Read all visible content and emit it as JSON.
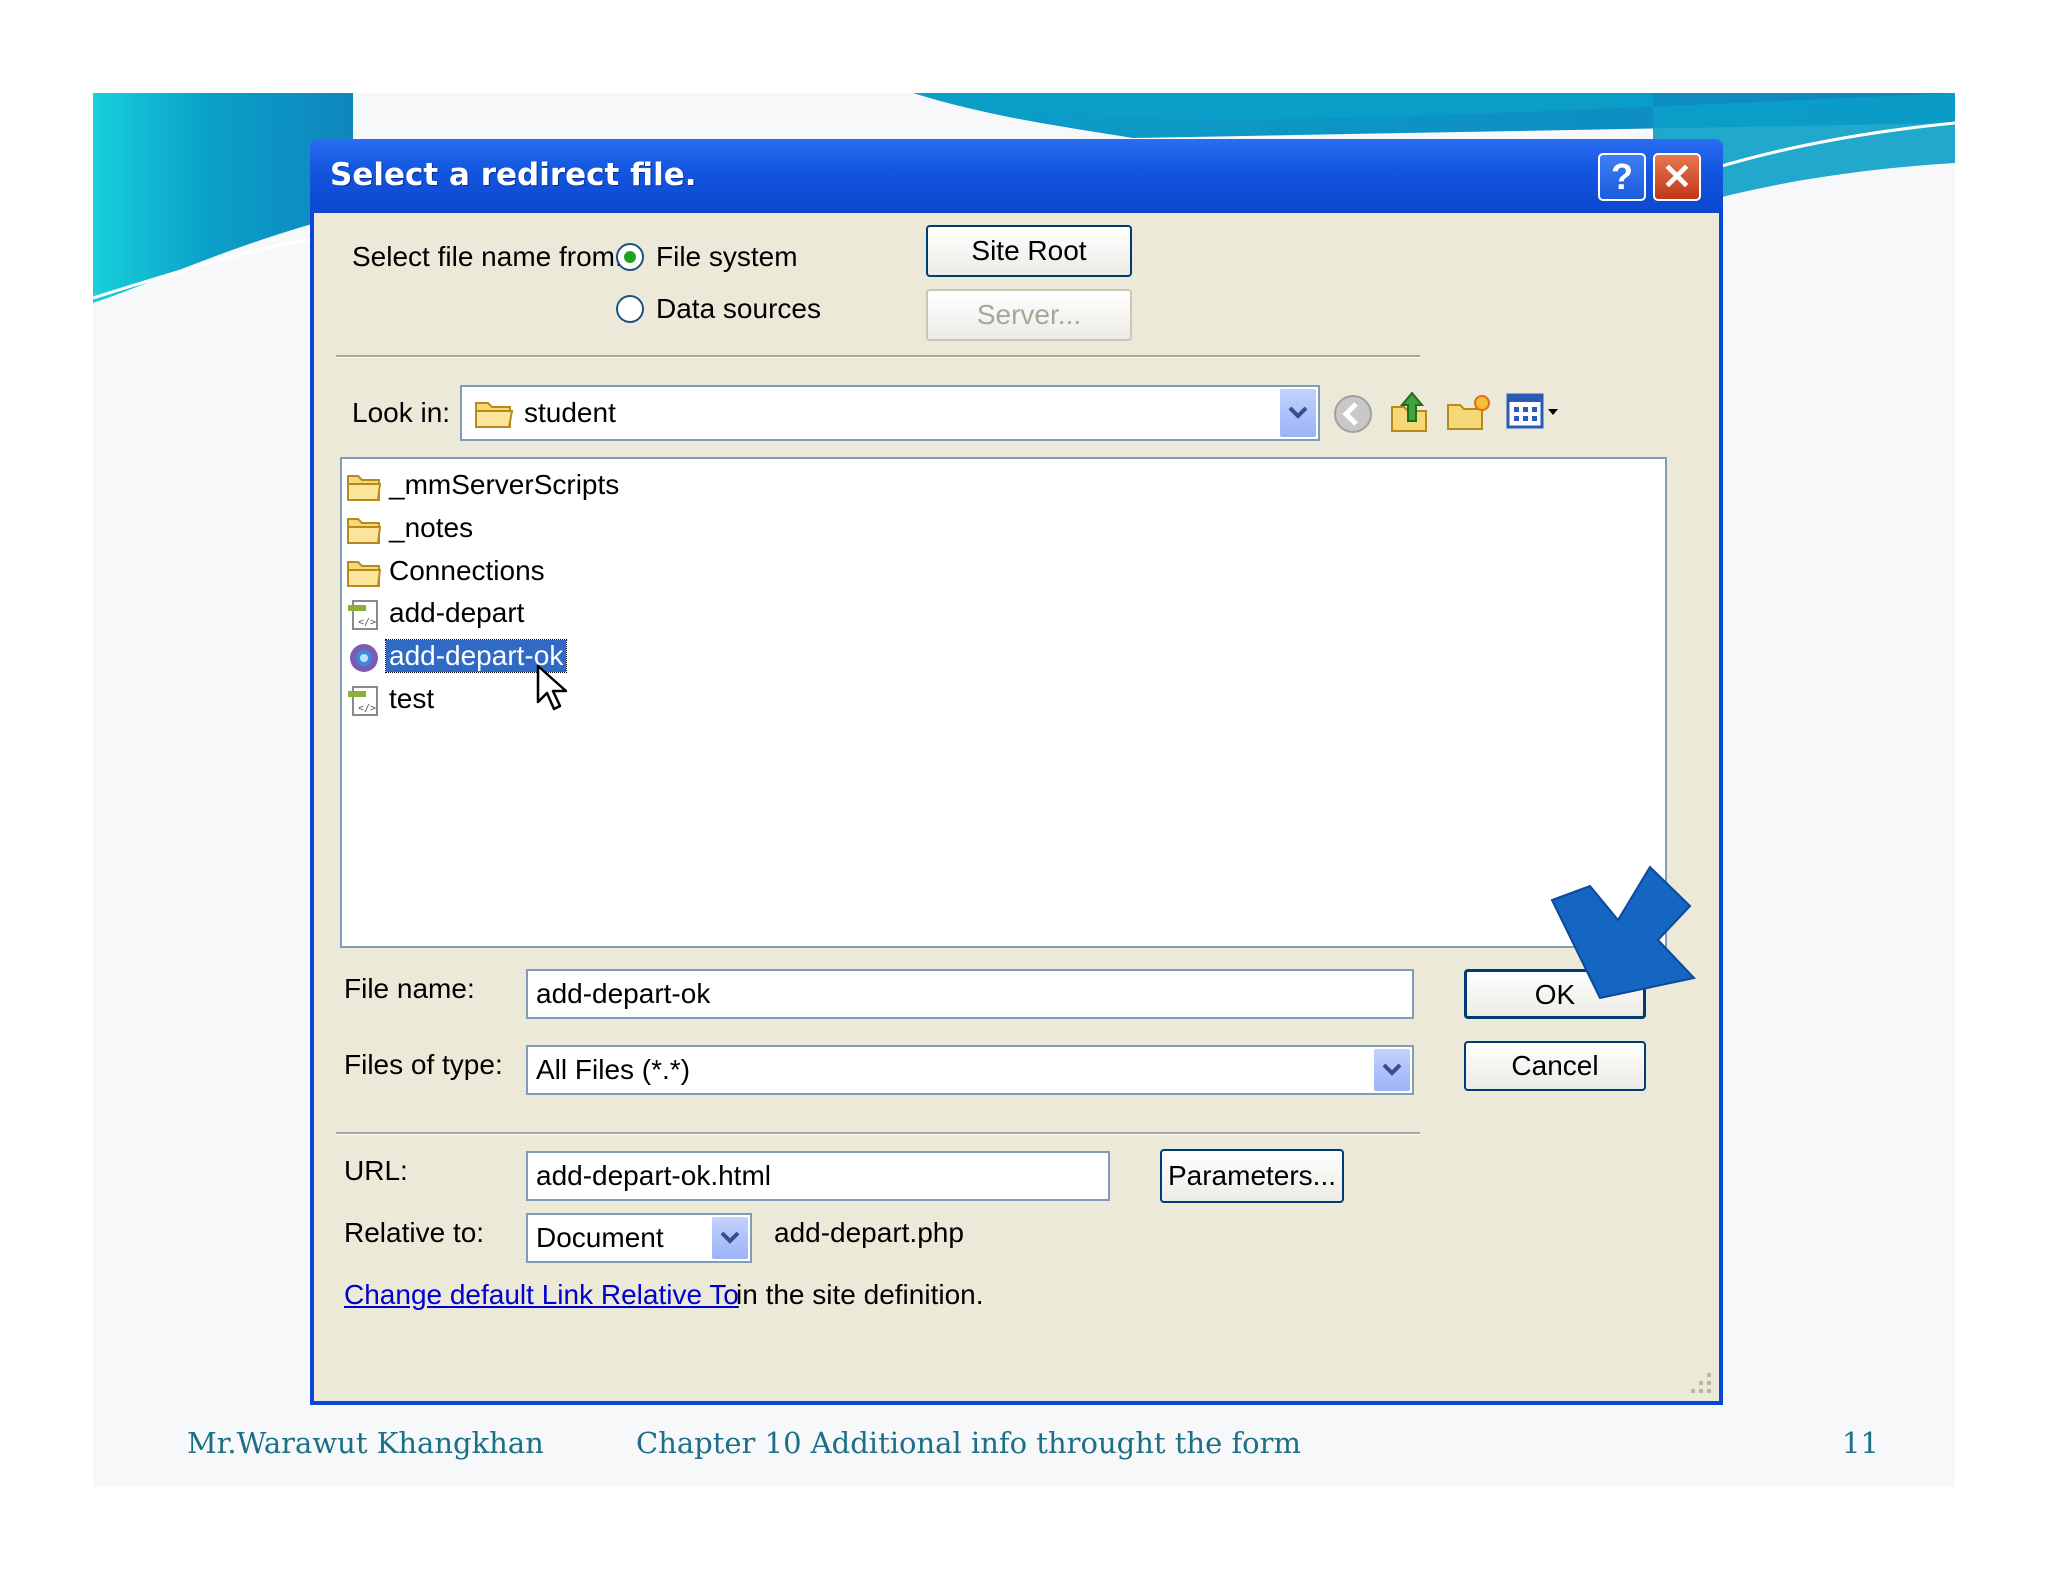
{
  "dialog": {
    "title": "Select a redirect file.",
    "help_glyph": "?",
    "close_glyph": "✕"
  },
  "source": {
    "label": "Select file name from:",
    "options": [
      "File system",
      "Data sources"
    ],
    "selected": "File system",
    "site_root_button": "Site Root",
    "server_button": "Server..."
  },
  "lookin": {
    "label": "Look in:",
    "value": "student",
    "toolbar_icons": [
      "back-icon",
      "up-folder-icon",
      "new-folder-icon",
      "view-menu-icon"
    ]
  },
  "files": [
    {
      "name": "_mmServerScripts",
      "icon": "folder-icon",
      "selected": false
    },
    {
      "name": "_notes",
      "icon": "folder-icon",
      "selected": false
    },
    {
      "name": "Connections",
      "icon": "folder-icon",
      "selected": false
    },
    {
      "name": "add-depart",
      "icon": "php-file-icon",
      "selected": false
    },
    {
      "name": "add-depart-ok",
      "icon": "html-file-icon",
      "selected": true
    },
    {
      "name": "test",
      "icon": "php-file-icon",
      "selected": false
    }
  ],
  "filename": {
    "label": "File name:",
    "value": "add-depart-ok"
  },
  "filetype": {
    "label": "Files of type:",
    "value": "All Files (*.*)"
  },
  "buttons": {
    "ok": "OK",
    "cancel": "Cancel",
    "parameters": "Parameters..."
  },
  "url": {
    "label": "URL:",
    "value": "add-depart-ok.html"
  },
  "relative": {
    "label": "Relative to:",
    "value": "Document",
    "file": "add-depart.php"
  },
  "change_link": {
    "link_text": "Change default Link Relative To",
    "suffix": "in the site definition."
  },
  "footer": {
    "author": "Mr.Warawut  Khangkhan",
    "chapter": "Chapter 10 Additional info throught the form",
    "page": "11"
  },
  "colors": {
    "titlebar": "#0c47cf",
    "dialog_bg": "#ece9d8",
    "selection": "#316ac5",
    "callout_arrow": "#1466c2",
    "footer_text": "#1b6f86",
    "link": "#0000cc"
  }
}
